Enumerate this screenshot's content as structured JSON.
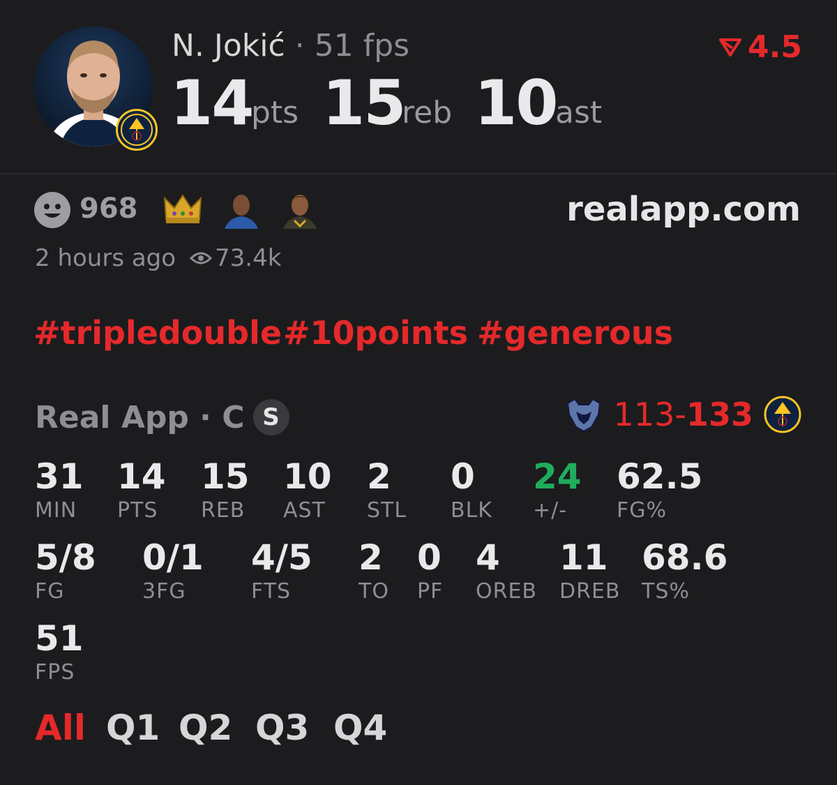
{
  "header": {
    "player_name": "N. Jokić",
    "separator": "·",
    "fps_text": "51 fps",
    "stats": [
      {
        "value": "14",
        "unit": "pts"
      },
      {
        "value": "15",
        "unit": "reb"
      },
      {
        "value": "10",
        "unit": "ast"
      }
    ],
    "line_value": "4.5",
    "line_icon": "trending-down-icon"
  },
  "reactions": {
    "count": "968",
    "time_ago": "2 hours ago",
    "views": "73.4k",
    "site": "realapp.com"
  },
  "hashtags": [
    "#tripledouble",
    "#10points",
    "#generous"
  ],
  "game": {
    "source": "Real App · C",
    "badge": "S",
    "away_score": "113",
    "dash": "-",
    "home_score": "133",
    "away_team_icon": "grizzlies-logo-icon",
    "home_team_icon": "nuggets-logo-icon"
  },
  "stat_rows": [
    [
      {
        "value": "31",
        "label": "MIN"
      },
      {
        "value": "14",
        "label": "PTS"
      },
      {
        "value": "15",
        "label": "REB"
      },
      {
        "value": "10",
        "label": "AST"
      },
      {
        "value": "2",
        "label": "STL"
      },
      {
        "value": "0",
        "label": "BLK"
      },
      {
        "value": "24",
        "label": "+/-"
      },
      {
        "value": "62.5",
        "label": "FG%"
      }
    ],
    [
      {
        "value": "5/8",
        "label": "FG"
      },
      {
        "value": "0/1",
        "label": "3FG"
      },
      {
        "value": "4/5",
        "label": "FTS"
      },
      {
        "value": "2",
        "label": "TO"
      },
      {
        "value": "0",
        "label": "PF"
      },
      {
        "value": "4",
        "label": "OREB"
      },
      {
        "value": "11",
        "label": "DREB"
      },
      {
        "value": "68.6",
        "label": "TS%"
      }
    ],
    [
      {
        "value": "51",
        "label": "FPS"
      }
    ]
  ],
  "colors": {
    "accent": "#e5292b",
    "positive": "#1fad5c",
    "background": "#1c1c1e"
  },
  "quarters": [
    "All",
    "Q1",
    "Q2",
    "Q3",
    "Q4"
  ],
  "active_quarter": "All"
}
